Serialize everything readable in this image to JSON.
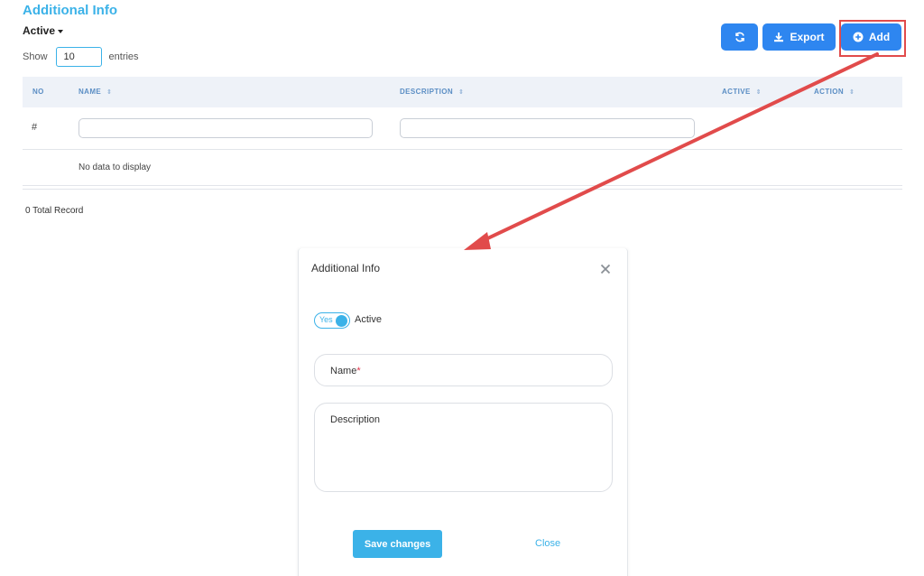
{
  "page": {
    "title": "Additional Info",
    "status_filter": "Active",
    "show_label": "Show",
    "entries_value": "10",
    "entries_label": "entries"
  },
  "toolbar": {
    "refresh_icon": "refresh-icon",
    "export_icon": "download-icon",
    "export_label": "Export",
    "add_icon": "plus-circle-icon",
    "add_label": "Add",
    "accent_color": "#2e86f0"
  },
  "table": {
    "columns": [
      "NO",
      "NAME",
      "DESCRIPTION",
      "ACTIVE",
      "ACTION"
    ],
    "filter_row_marker": "#",
    "empty_message": "No data to display",
    "total_records": "0 Total Record"
  },
  "modal": {
    "title": "Additional Info",
    "close_icon": "close-icon",
    "toggle_value": "Yes",
    "toggle_label": "Active",
    "name_label": "Name",
    "required_marker": "*",
    "description_label": "Description",
    "save_label": "Save changes",
    "close_label": "Close",
    "primary_color": "#3bb2e8"
  },
  "annotation": {
    "highlight_color": "#e14b4b"
  }
}
